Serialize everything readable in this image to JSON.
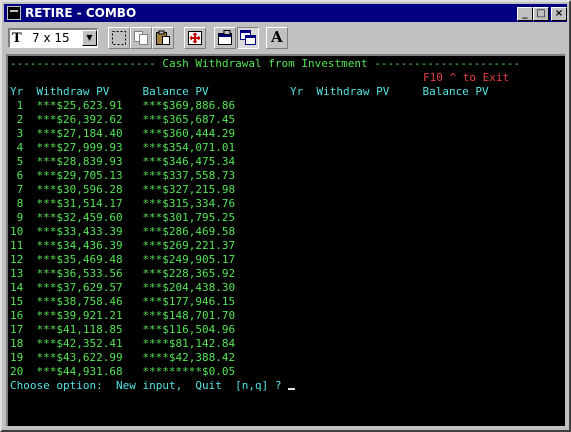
{
  "window": {
    "title": "RETIRE - COMBO"
  },
  "title_buttons": {
    "minimize": "_",
    "maximize": "□",
    "close": "×"
  },
  "toolbar": {
    "font_size": "7 x 15",
    "tools": [
      "mark-icon",
      "copy-icon",
      "paste-icon",
      "fullscreen-icon",
      "properties-icon",
      "background-icon",
      "font-icon"
    ],
    "font_button_label": "A"
  },
  "console": {
    "banner": "---------------------- Cash Withdrawal from Investment ----------------------",
    "exit_hint": "F10 ^ to Exit",
    "header_left": "Yr  Withdraw PV     Balance PV",
    "header_right": "Yr  Withdraw PV     Balance PV",
    "rows": [
      {
        "yr": "1",
        "withdraw": "***$25,623.91",
        "balance": "***$369,886.86"
      },
      {
        "yr": "2",
        "withdraw": "***$26,392.62",
        "balance": "***$365,687.45"
      },
      {
        "yr": "3",
        "withdraw": "***$27,184.40",
        "balance": "***$360,444.29"
      },
      {
        "yr": "4",
        "withdraw": "***$27,999.93",
        "balance": "***$354,071.01"
      },
      {
        "yr": "5",
        "withdraw": "***$28,839.93",
        "balance": "***$346,475.34"
      },
      {
        "yr": "6",
        "withdraw": "***$29,705.13",
        "balance": "***$337,558.73"
      },
      {
        "yr": "7",
        "withdraw": "***$30,596.28",
        "balance": "***$327,215.98"
      },
      {
        "yr": "8",
        "withdraw": "***$31,514.17",
        "balance": "***$315,334.76"
      },
      {
        "yr": "9",
        "withdraw": "***$32,459.60",
        "balance": "***$301,795.25"
      },
      {
        "yr": "10",
        "withdraw": "***$33,433.39",
        "balance": "***$286,469.58"
      },
      {
        "yr": "11",
        "withdraw": "***$34,436.39",
        "balance": "***$269,221.37"
      },
      {
        "yr": "12",
        "withdraw": "***$35,469.48",
        "balance": "***$249,905.17"
      },
      {
        "yr": "13",
        "withdraw": "***$36,533.56",
        "balance": "***$228,365.92"
      },
      {
        "yr": "14",
        "withdraw": "***$37,629.57",
        "balance": "***$204,438.30"
      },
      {
        "yr": "15",
        "withdraw": "***$38,758.46",
        "balance": "***$177,946.15"
      },
      {
        "yr": "16",
        "withdraw": "***$39,921.21",
        "balance": "***$148,701.70"
      },
      {
        "yr": "17",
        "withdraw": "***$41,118.85",
        "balance": "***$116,504.96"
      },
      {
        "yr": "18",
        "withdraw": "***$42,352.41",
        "balance": "****$81,142.84"
      },
      {
        "yr": "19",
        "withdraw": "***$43,622.99",
        "balance": "****$42,388.42"
      },
      {
        "yr": "20",
        "withdraw": "***$44,931.68",
        "balance": "*********$0.05"
      }
    ],
    "prompt": "Choose option:  New input,  Quit  [n,q] ? ",
    "colors": {
      "background": "#000000",
      "text": "#54e354",
      "prompt": "#54e3e3",
      "hint": "#e34040"
    }
  }
}
